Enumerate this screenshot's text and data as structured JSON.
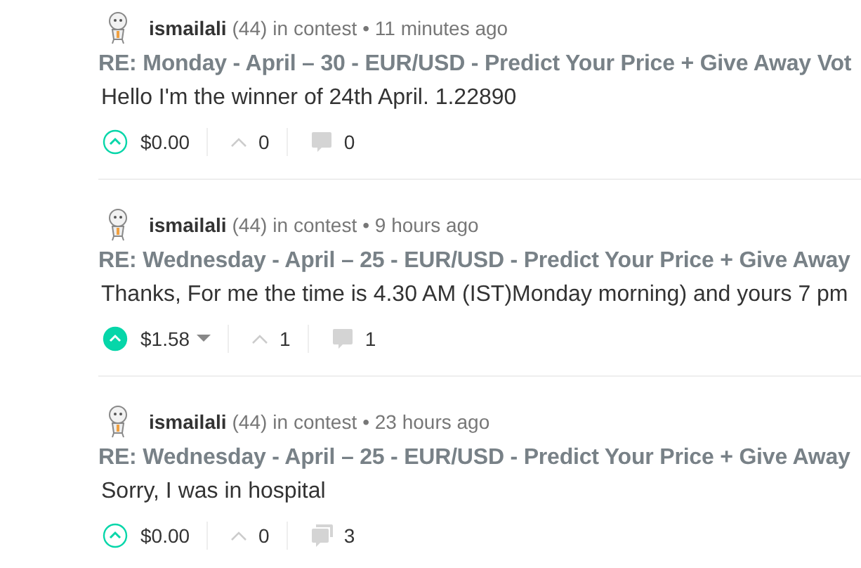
{
  "comments": [
    {
      "author": "ismailali",
      "reputation": "(44)",
      "context": "in contest",
      "time": "• 11 minutes ago",
      "title": "RE: Monday - April – 30 - EUR/USD - Predict Your Price + Give Away Vot",
      "body": "Hello I'm the winner of 24th April. 1.22890",
      "voted": false,
      "payout": "$0.00",
      "payout_expandable": false,
      "votes": "0",
      "replies": "0",
      "kind": "single"
    },
    {
      "author": "ismailali",
      "reputation": "(44)",
      "context": "in contest",
      "time": "• 9 hours ago",
      "title": "RE: Wednesday - April – 25 - EUR/USD - Predict Your Price + Give Away",
      "body": "Thanks, For me the time is 4.30 AM (IST)Monday morning) and yours 7 pm",
      "voted": true,
      "payout": "$1.58",
      "payout_expandable": true,
      "votes": "1",
      "replies": "1",
      "kind": "single"
    },
    {
      "author": "ismailali",
      "reputation": "(44)",
      "context": "in contest",
      "time": "• 23 hours ago",
      "title": "RE: Wednesday - April – 25 - EUR/USD - Predict Your Price + Give Away",
      "body": "Sorry, I was in hospital",
      "voted": false,
      "payout": "$0.00",
      "payout_expandable": false,
      "votes": "0",
      "replies": "3",
      "kind": "stacked"
    }
  ]
}
